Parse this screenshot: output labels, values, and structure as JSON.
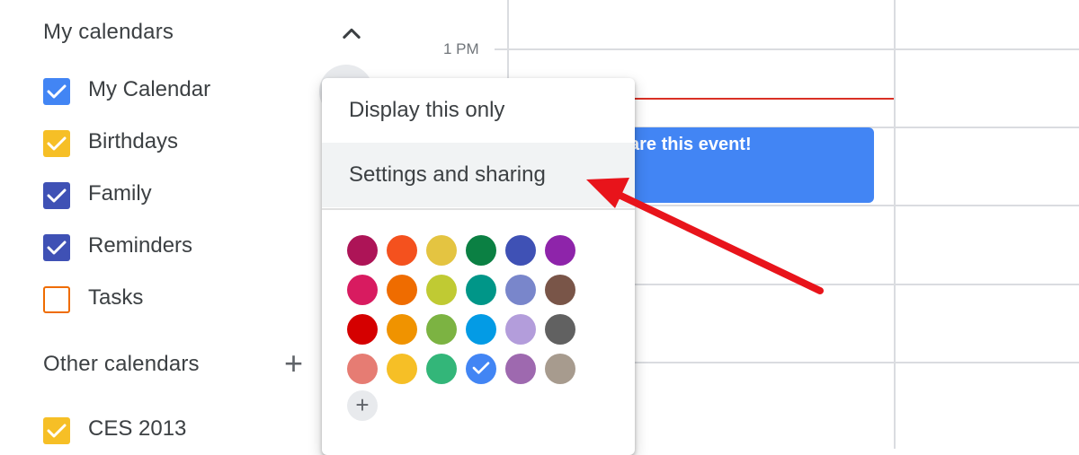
{
  "sidebar": {
    "my_calendars_title": "My calendars",
    "other_calendars_title": "Other calendars",
    "my_calendars": [
      {
        "label": "My Calendar",
        "color": "#4285f4",
        "checked": true
      },
      {
        "label": "Birthdays",
        "color": "#f6bf26",
        "checked": true
      },
      {
        "label": "Family",
        "color": "#3f51b5",
        "checked": true
      },
      {
        "label": "Reminders",
        "color": "#3f51b5",
        "checked": true
      },
      {
        "label": "Tasks",
        "color": "#ef6c00",
        "checked": false
      }
    ],
    "other_calendars": [
      {
        "label": "CES 2013",
        "color": "#f6bf26",
        "checked": true
      }
    ],
    "collapse_icon": "chevron-up-icon",
    "add_icon": "plus-icon"
  },
  "grid": {
    "time_label": "1 PM",
    "event_title": "are this event!",
    "event_color": "#4285f4",
    "now_line_color": "#d93025"
  },
  "menu": {
    "items": [
      {
        "label": "Display this only"
      },
      {
        "label": "Settings and sharing",
        "highlighted": true
      }
    ],
    "colors": [
      [
        "#ad1457",
        "#f4511e",
        "#e4c441",
        "#0b8043",
        "#3f51b5",
        "#8e24aa"
      ],
      [
        "#d81b60",
        "#ef6c00",
        "#c0ca33",
        "#009688",
        "#7986cb",
        "#795548"
      ],
      [
        "#d50000",
        "#f09300",
        "#7cb342",
        "#039be5",
        "#b39ddb",
        "#616161"
      ],
      [
        "#e67c73",
        "#f6bf26",
        "#33b679",
        "#4285f4",
        "#9e69af",
        "#a79b8e"
      ]
    ],
    "selected_color": "#4285f4",
    "add_color_icon": "plus-icon",
    "add_color_label": "+"
  },
  "annotation": {
    "arrow_color": "#e8141b"
  }
}
